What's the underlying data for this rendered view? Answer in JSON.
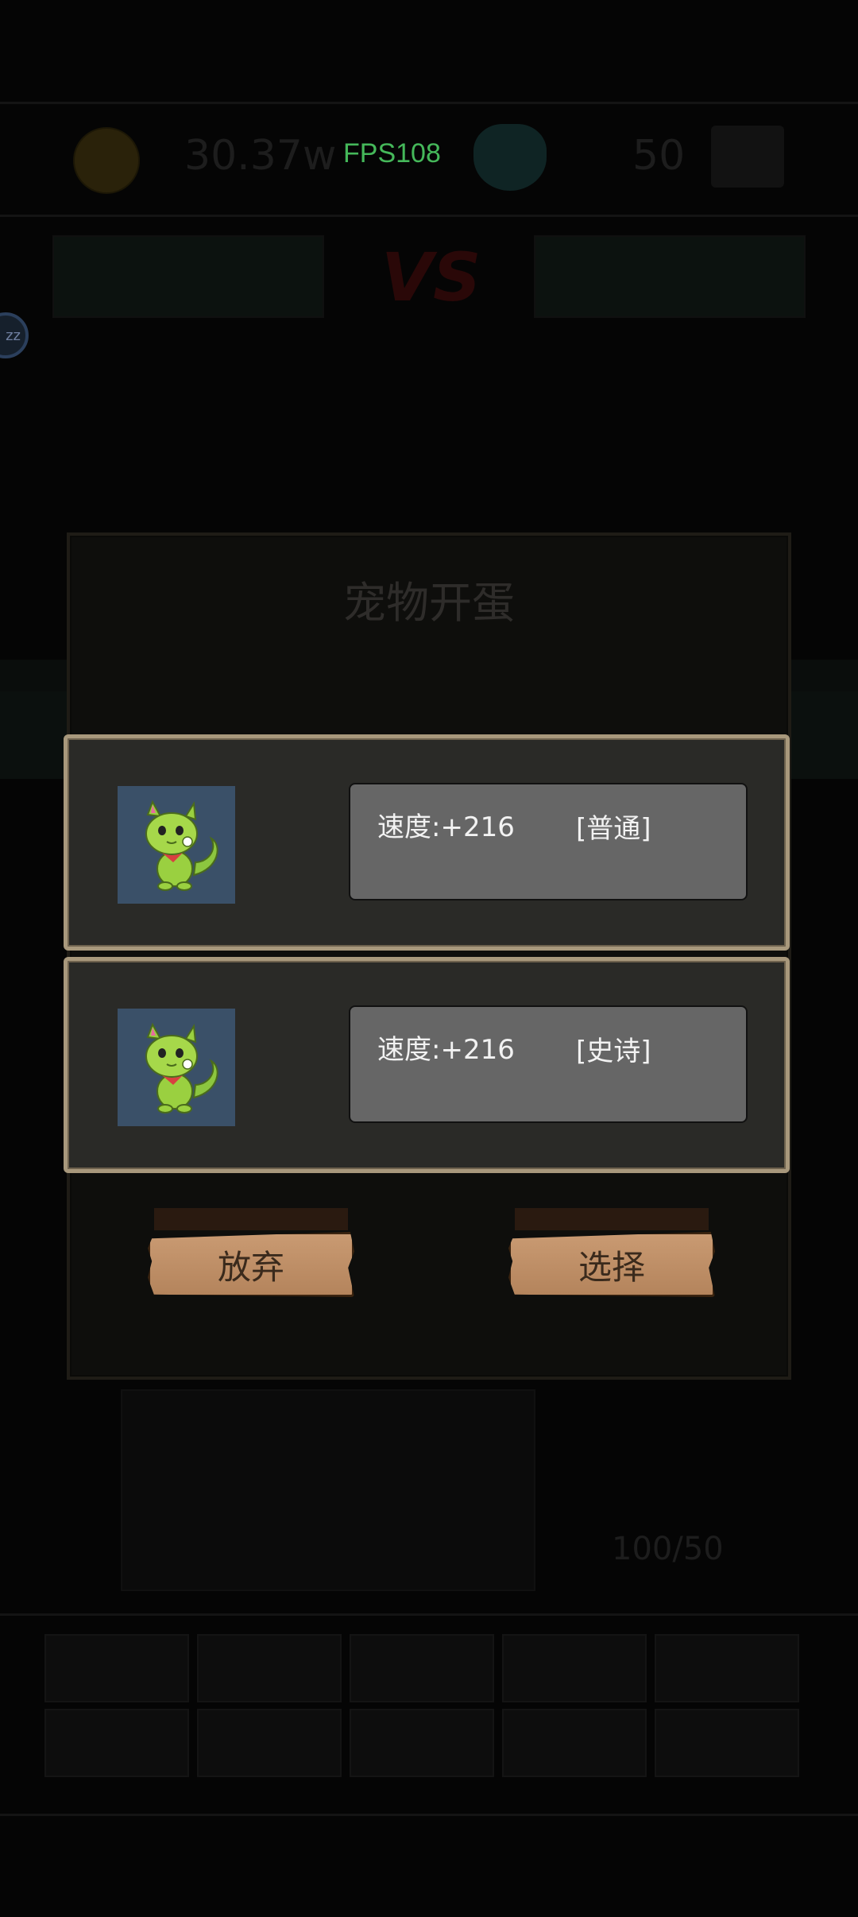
{
  "hud": {
    "fps": "FPS108",
    "coins": "30.37w",
    "gems": "50"
  },
  "modal": {
    "title": "宠物开蛋",
    "options": [
      {
        "stat": "速度:+216",
        "rarity": "[普通]",
        "icon": "green-cat-pet-icon"
      },
      {
        "stat": "速度:+216",
        "rarity": "[史诗]",
        "icon": "green-cat-pet-icon"
      }
    ],
    "abandon_label": "放弃",
    "select_label": "选择"
  },
  "background": {
    "vs": "VS",
    "bottom_counter": "100/50"
  }
}
